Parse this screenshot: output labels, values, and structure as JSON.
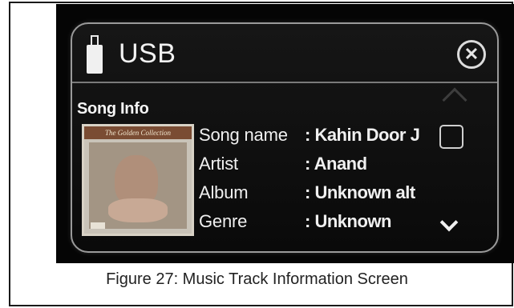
{
  "header": {
    "title": "USB"
  },
  "section": {
    "title": "Song Info"
  },
  "album_art": {
    "band_text": "The Golden Collection"
  },
  "track": [
    {
      "label": "Song name",
      "value": ": Kahin Door J"
    },
    {
      "label": "Artist",
      "value": ": Anand"
    },
    {
      "label": "Album",
      "value": ": Unknown alt"
    },
    {
      "label": "Genre",
      "value": ": Unknown"
    }
  ],
  "caption": "Figure 27: Music Track Information Screen",
  "colors": {
    "panel_bg": "#0a0a0a",
    "text": "#f0f0f0",
    "border": "#9a9a9a"
  },
  "icons": [
    "usb-icon",
    "close-icon",
    "checkbox-icon",
    "scroll-up-icon",
    "scroll-down-icon"
  ]
}
